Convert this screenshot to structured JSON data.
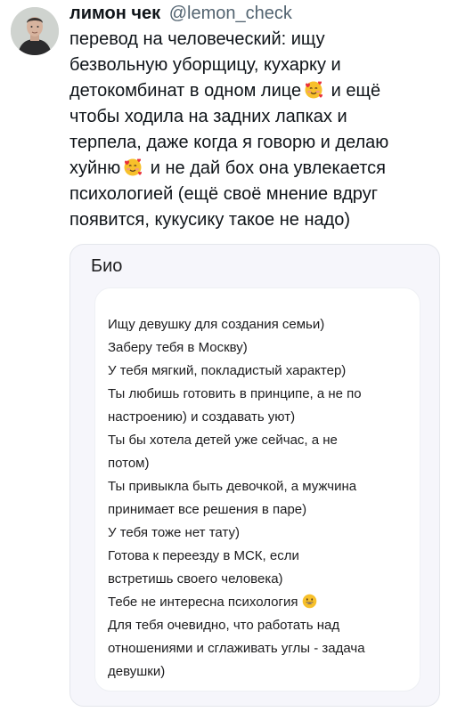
{
  "tweet": {
    "author": {
      "display_name": "лимон чек",
      "handle": "@lemon_check",
      "avatar_icon": "user-avatar"
    },
    "menu_icon": "more-dots-icon",
    "text_lines": [
      "перевод на человеческий: ищу",
      "безвольную уборщицу, кухарку и",
      "детокомбинат в одном лице",
      " и ещё",
      "чтобы ходила на задних лапках и",
      "терпела, даже когда я говорю и делаю",
      "хуйню",
      " и не дай бох она увлекается",
      "психологией (ещё своё мнение вдруг",
      "появится, кукусику такое не надо)"
    ],
    "emoji_icon": "smiling-face-with-hearts-icon"
  },
  "media": {
    "bio_title": "Био",
    "bio_lines": [
      "Ищу девушку для создания семьи)",
      "Заберу тебя в Москву)",
      "У тебя мягкий, покладистый характер)",
      "Ты любишь готовить в принципе, а не по",
      "настроению) и создавать уют)",
      "Ты бы хотела детей уже сейчас, а не",
      "потом)",
      "Ты привыкла быть девочкой, а мужчина",
      "принимает все решения в паре)",
      "У тебя тоже нет тату)",
      "Готова к переезду в МСК, если",
      "встретишь своего человека)",
      "Тебе не интересна психология",
      "Для тебя очевидно, что работать над",
      "отношениями и сглаживать углы - задача",
      "девушки)"
    ],
    "bio_emoji_icon": "grinning-face-icon"
  },
  "colors": {
    "text": "#0f1419",
    "handle": "#536471",
    "card_bg": "#f6f6fb",
    "bio_box_bg": "#ffffff"
  }
}
